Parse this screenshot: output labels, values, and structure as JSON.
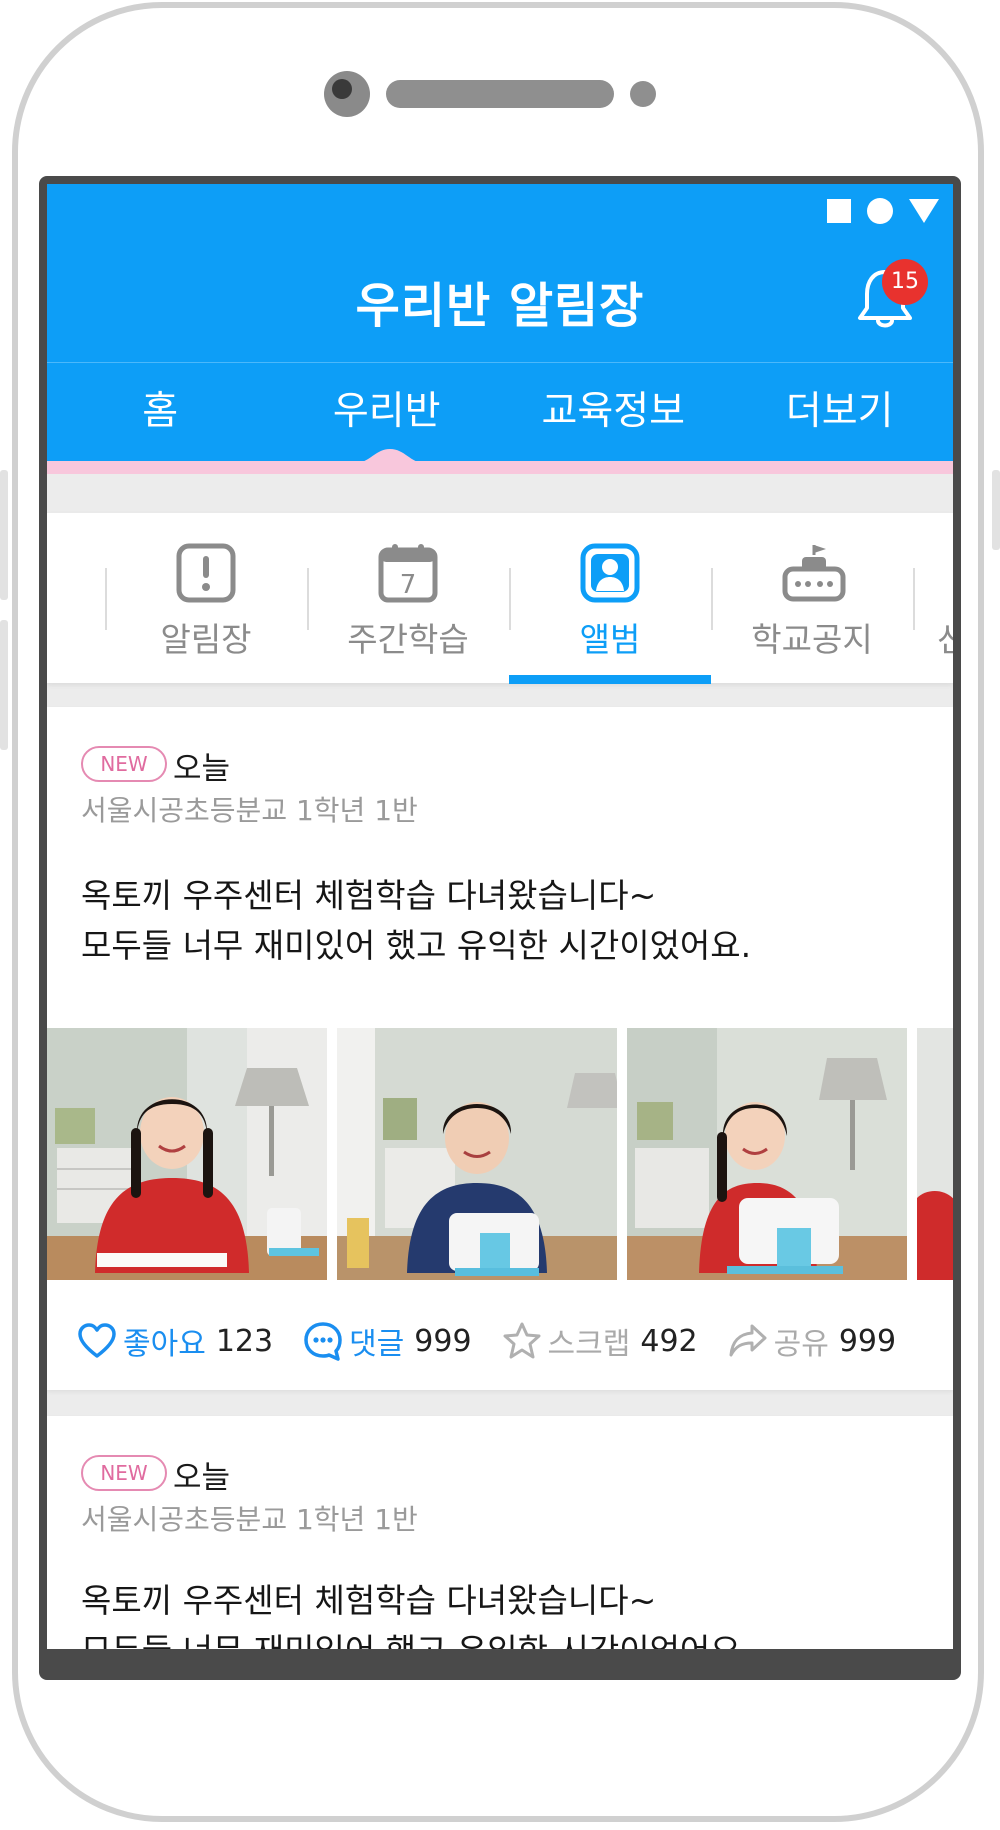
{
  "header": {
    "title": "우리반 알림장",
    "notification_count": "15"
  },
  "main_tabs": [
    {
      "label": "홈"
    },
    {
      "label": "우리반"
    },
    {
      "label": "교육정보"
    },
    {
      "label": "더보기"
    }
  ],
  "sub_tabs": [
    {
      "label": "알림장",
      "icon": "notice-icon"
    },
    {
      "label": "주간학습",
      "icon": "calendar-icon",
      "calendar_day": "7"
    },
    {
      "label": "앨범",
      "icon": "album-icon",
      "active": true
    },
    {
      "label": "학교공지",
      "icon": "school-notice-icon"
    },
    {
      "label": "선"
    }
  ],
  "posts": [
    {
      "badge": "NEW",
      "date": "오늘",
      "class": "서울시공초등분교 1학년 1반",
      "body": "옥토끼 우주센터 체험학습 다녀왔습니다~\n모두들 너무 재미있어 했고 유익한 시간이었어요.",
      "actions": {
        "like_label": "좋아요",
        "like_count": "123",
        "comment_label": "댓글",
        "comment_count": "999",
        "scrap_label": "스크랩",
        "scrap_count": "492",
        "share_label": "공유",
        "share_count": "999"
      }
    },
    {
      "badge": "NEW",
      "date": "오늘",
      "class": "서울시공초등분교 1학년 1반",
      "body": "옥토끼 우주센터 체험학습 다녀왔습니다~\n모두들 너무 재미있어 했고 유익한 시간이었어요."
    }
  ],
  "colors": {
    "primary": "#0d9ef7",
    "pink_accent": "#f8c7dc",
    "badge_red": "#e8322e",
    "new_badge": "#e06b9f"
  }
}
